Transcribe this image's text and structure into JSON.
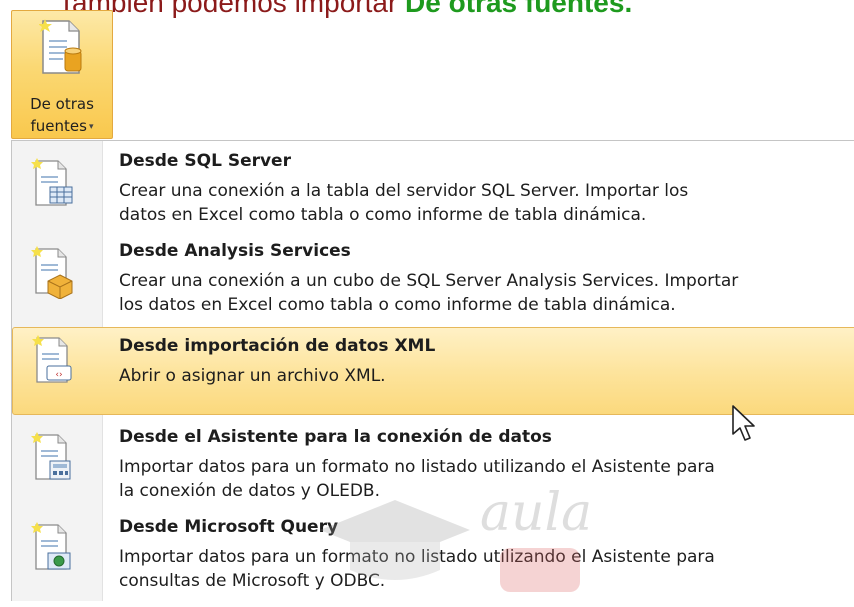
{
  "caption": {
    "prefix": "También podemos importar ",
    "highlight": "De otras fuentes."
  },
  "ribbon_button": {
    "line1": "De otras",
    "line2": "fuentes",
    "dropdown_glyph": "▾",
    "icon": "database-document-icon"
  },
  "menu": {
    "items": [
      {
        "title": "Desde SQL Server",
        "desc1": "Crear una conexión a la tabla del servidor SQL Server. Importar los",
        "desc2": "datos en Excel como tabla o como informe de tabla dinámica.",
        "icon": "sql-server-table-icon"
      },
      {
        "title": "Desde Analysis Services",
        "desc1": "Crear una conexión a un cubo de SQL Server Analysis Services. Importar",
        "desc2": "los datos en Excel como tabla o como informe de tabla dinámica.",
        "icon": "analysis-cube-icon"
      },
      {
        "title": "Desde importación de datos XML",
        "desc1": "Abrir o asignar un archivo XML.",
        "desc2": "",
        "icon": "xml-import-icon",
        "highlighted": true
      },
      {
        "title": "Desde el Asistente para la conexión de datos",
        "desc1": "Importar datos para un formato no listado utilizando el Asistente para",
        "desc2": "la conexión de datos y OLEDB.",
        "icon": "data-wizard-icon"
      },
      {
        "title": "Desde Microsoft Query",
        "desc1": "Importar datos para un formato no listado utilizando el Asistente para",
        "desc2": "consultas de Microsoft y ODBC.",
        "icon": "microsoft-query-icon"
      }
    ]
  },
  "watermark": {
    "text": "aula"
  },
  "colors": {
    "caption_red": "#8b1a1a",
    "caption_green": "#1e9a1e",
    "highlight": "#fde39a",
    "highlight_border": "#e6b85a"
  }
}
